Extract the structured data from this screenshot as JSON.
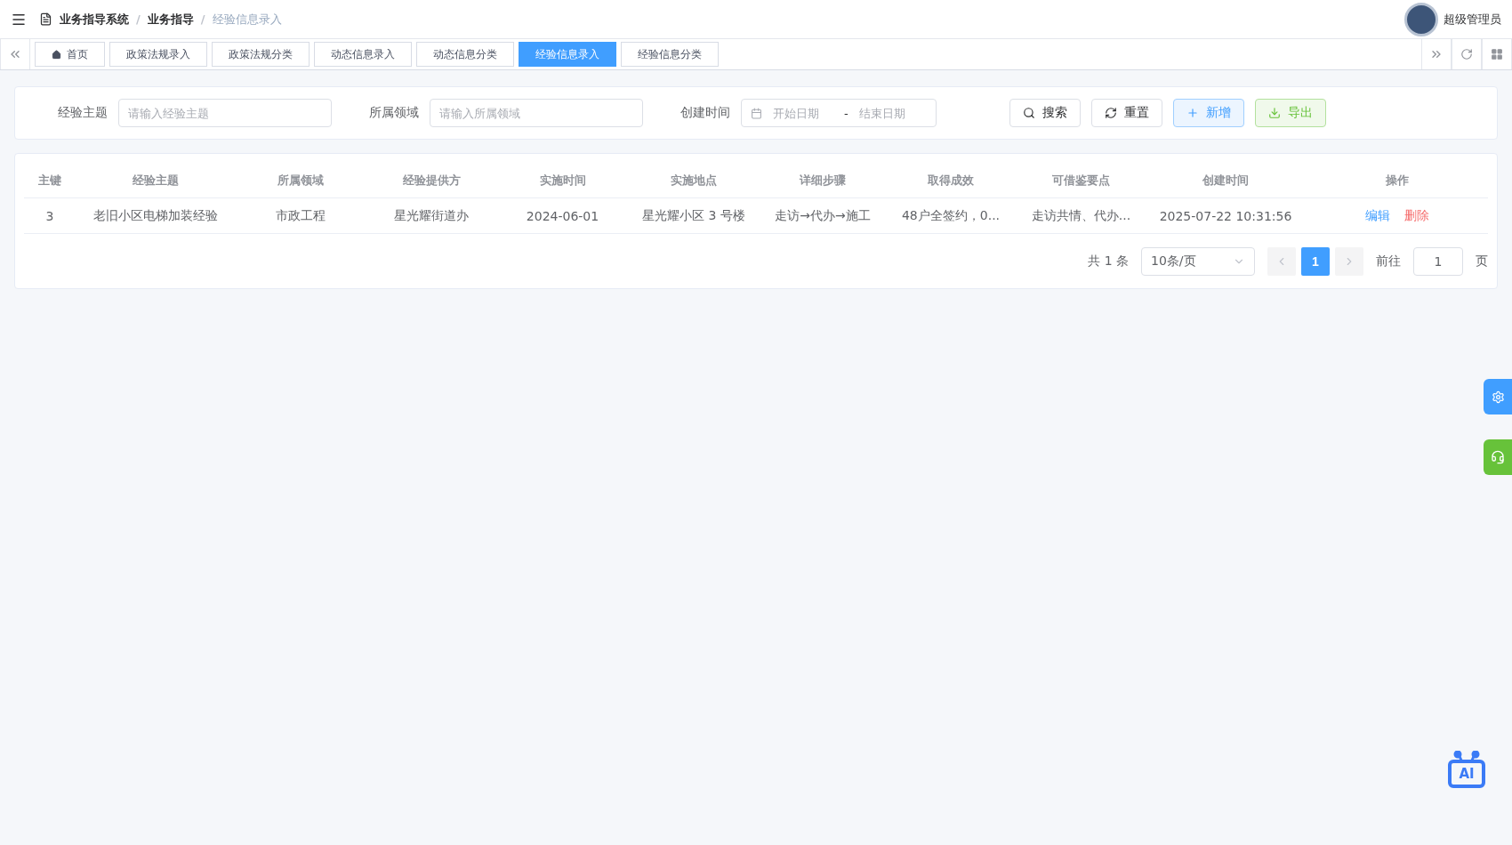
{
  "header": {
    "breadcrumb": [
      {
        "label": "业务指导系统",
        "current": false
      },
      {
        "label": "业务指导",
        "current": false
      },
      {
        "label": "经验信息录入",
        "current": true
      }
    ],
    "separator": "/",
    "user": "超级管理员"
  },
  "tabs": [
    {
      "label": "首页",
      "selected": false,
      "kind": "home"
    },
    {
      "label": "政策法规录入",
      "selected": false,
      "kind": "plain"
    },
    {
      "label": "政策法规分类",
      "selected": false,
      "kind": "plain"
    },
    {
      "label": "动态信息录入",
      "selected": false,
      "kind": "plain"
    },
    {
      "label": "动态信息分类",
      "selected": false,
      "kind": "plain"
    },
    {
      "label": "经验信息录入",
      "selected": true,
      "kind": "plain"
    },
    {
      "label": "经验信息分类",
      "selected": false,
      "kind": "plain"
    }
  ],
  "filters": [
    {
      "label": "经验主题",
      "placeholder": "请输入经验主题",
      "kind": "text"
    },
    {
      "label": "所属领域",
      "placeholder": "请输入所属领域",
      "kind": "text"
    },
    {
      "label": "创建时间",
      "kind": "daterange",
      "start_placeholder": "开始日期",
      "separator": "-",
      "end_placeholder": "结束日期"
    }
  ],
  "actions": [
    {
      "label": "搜索",
      "kind": "search"
    },
    {
      "label": "重置",
      "kind": "reset"
    },
    {
      "label": "新增",
      "kind": "add"
    },
    {
      "label": "导出",
      "kind": "export"
    }
  ],
  "table": {
    "columns": [
      "主键",
      "经验主题",
      "所属领域",
      "经验提供方",
      "实施时间",
      "实施地点",
      "详细步骤",
      "取得成效",
      "可借鉴要点",
      "创建时间",
      "操作"
    ],
    "rows": [
      {
        "cells": [
          "3",
          "老旧小区电梯加装经验",
          "市政工程",
          "星光耀街道办",
          "2024-06-01",
          "星光耀小区 3 号楼",
          "走访→代办→施工",
          "48户全签约，0...",
          "走访共情、代办...",
          "2025-07-22 10:31:56"
        ],
        "actions": [
          "编辑",
          "删除"
        ]
      }
    ]
  },
  "pagination": {
    "total": "共 1 条",
    "page_size": "10条/页",
    "pages": [
      {
        "label": "1",
        "selected": true
      }
    ],
    "goto_label": "前往",
    "goto_value": "1",
    "goto_suffix": "页"
  },
  "ai_assistant": {
    "label": "AI"
  }
}
